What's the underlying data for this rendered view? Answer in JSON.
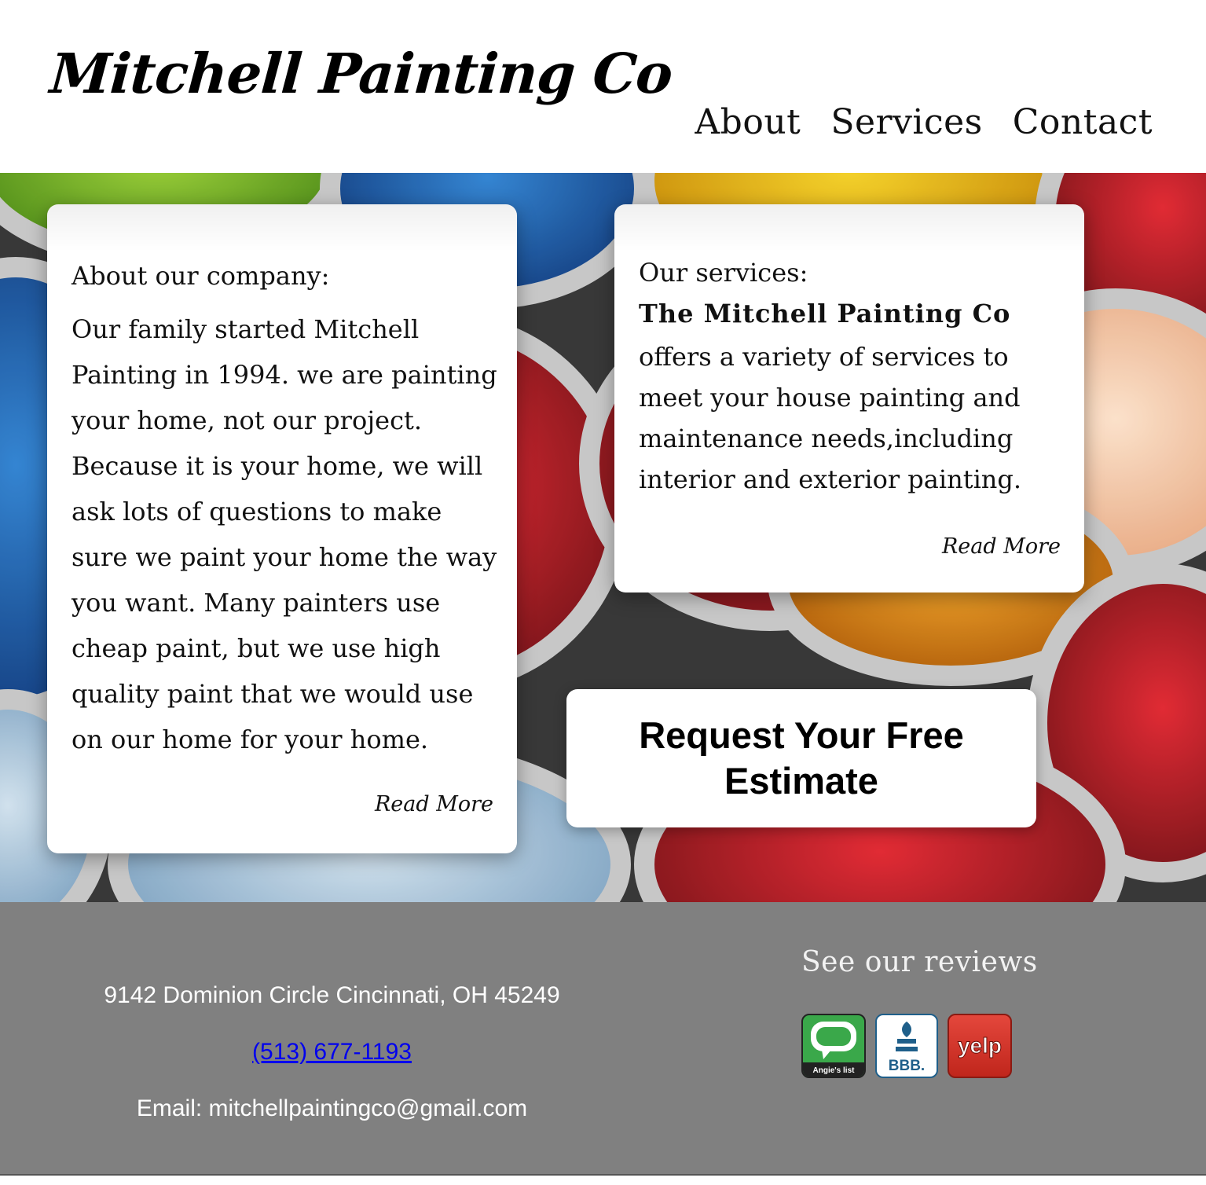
{
  "header": {
    "logo": "Mitchell Painting Co",
    "nav": [
      "About",
      "Services",
      "Contact"
    ]
  },
  "about_card": {
    "title": "About our company:",
    "body": "Our family started Mitchell Painting in 1994. we are painting your home, not our project. Because it is your home, we will ask lots of questions to make sure we paint your home the way you want. Many painters use cheap paint, but we use high quality paint that we would use on our home for your home.",
    "read_more": "Read More"
  },
  "services_card": {
    "title": "Our services:",
    "company": "The Mitchell Painting Co",
    "body": "offers a variety of services to meet your house painting and maintenance needs,including interior and exterior painting.",
    "read_more": "Read More"
  },
  "cta": {
    "label": "Request Your Free Estimate"
  },
  "footer": {
    "address": "9142 Dominion Circle Cincinnati, OH 45249",
    "phone": "(513) 677-1193",
    "email": "Email: mitchellpaintingco@gmail.com",
    "reviews_title": "See our reviews",
    "badges": [
      {
        "name": "angies-list",
        "label": "Angie's list"
      },
      {
        "name": "bbb",
        "label": "BBB."
      },
      {
        "name": "yelp",
        "label": "yelp"
      }
    ]
  },
  "colors": {
    "footer_bg": "#808080",
    "link": "#0000ee",
    "angies_green": "#3aa84a",
    "bbb_blue": "#1f5f8a",
    "yelp_red": "#d32323"
  }
}
